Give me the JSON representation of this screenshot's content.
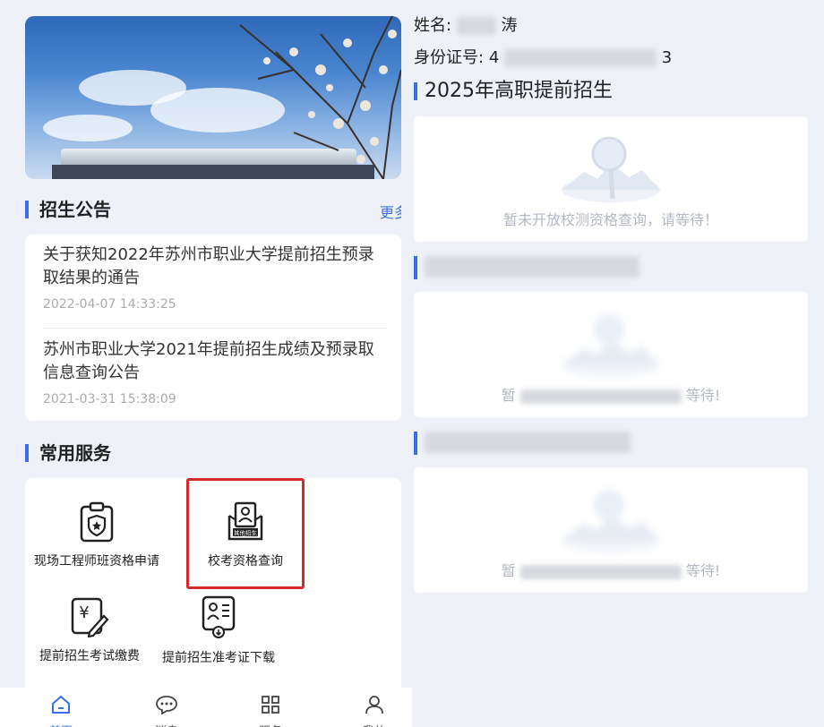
{
  "left": {
    "announcements": {
      "title": "招生公告",
      "more_label": "更多",
      "items": [
        {
          "title": "关于获知2022年苏州市职业大学提前招生预录取结果的通告",
          "date": "2022-04-07 14:33:25"
        },
        {
          "title": "苏州市职业大学2021年提前招生成绩及预录取信息查询公告",
          "date": "2021-03-31 15:38:09"
        }
      ]
    },
    "services": {
      "title": "常用服务",
      "items": [
        {
          "label": "现场工程师班资格申请",
          "icon": "badge-clipboard-icon"
        },
        {
          "label": "校考资格查询",
          "icon": "exam-certificate-icon",
          "icon_text": "其他招生"
        },
        {
          "label": "提前招生考试缴费",
          "icon": "yuan-payment-icon"
        },
        {
          "label": "提前招生准考证下载",
          "icon": "admission-ticket-icon"
        }
      ]
    },
    "bottom_nav": [
      {
        "label": "首页",
        "icon": "home-icon"
      },
      {
        "label": "消息",
        "icon": "message-icon"
      },
      {
        "label": "服务",
        "icon": "grid-icon"
      },
      {
        "label": "我的",
        "icon": "user-icon"
      }
    ]
  },
  "right": {
    "name_label": "姓名:",
    "name_tail": "涛",
    "id_label": "身份证号:",
    "id_head": "4",
    "id_tail": "3",
    "section_title": "2025年高职提前招生",
    "empty_text": "暂未开放校测资格查询，请等待！",
    "blurred_empty_head": "暂",
    "blurred_empty_tail": "等待!"
  },
  "colors": {
    "accent": "#3a6ee8",
    "highlight": "#d42a2a",
    "background": "#eef2f8"
  }
}
